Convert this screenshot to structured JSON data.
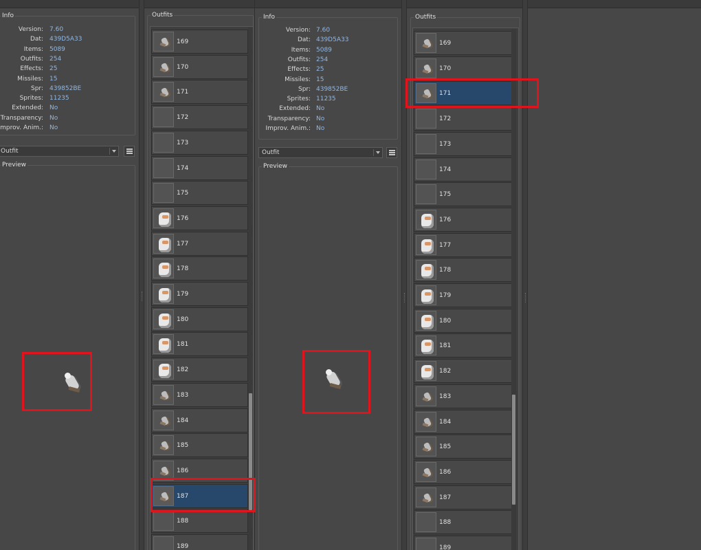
{
  "left": {
    "info": {
      "title": "Info",
      "rows": [
        {
          "key": "Version:",
          "value": "7.60"
        },
        {
          "key": "Dat:",
          "value": "439D5A33"
        },
        {
          "key": "Items:",
          "value": "5089"
        },
        {
          "key": "Outfits:",
          "value": "254"
        },
        {
          "key": "Effects:",
          "value": "25"
        },
        {
          "key": "Missiles:",
          "value": "15"
        },
        {
          "key": "Spr:",
          "value": "439852BE"
        },
        {
          "key": "Sprites:",
          "value": "11235"
        },
        {
          "key": "Extended:",
          "value": "No"
        },
        {
          "key": "Transparency:",
          "value": "No"
        },
        {
          "key": "Improv. Anim.:",
          "value": "No"
        }
      ]
    },
    "category_select": "Outfit",
    "preview_title": "Preview",
    "outfits_title": "Outfits",
    "outfits": [
      {
        "id": "169",
        "icon": "outfit-small-icon"
      },
      {
        "id": "170",
        "icon": "outfit-small-icon"
      },
      {
        "id": "171",
        "icon": "outfit-small-icon"
      },
      {
        "id": "172",
        "icon": ""
      },
      {
        "id": "173",
        "icon": ""
      },
      {
        "id": "174",
        "icon": ""
      },
      {
        "id": "175",
        "icon": ""
      },
      {
        "id": "176",
        "icon": "outfit-large-icon"
      },
      {
        "id": "177",
        "icon": "outfit-large-icon"
      },
      {
        "id": "178",
        "icon": "outfit-large-icon"
      },
      {
        "id": "179",
        "icon": "outfit-large-icon"
      },
      {
        "id": "180",
        "icon": "outfit-large-icon"
      },
      {
        "id": "181",
        "icon": "outfit-large-icon"
      },
      {
        "id": "182",
        "icon": "outfit-large-icon"
      },
      {
        "id": "183",
        "icon": "outfit-small-icon"
      },
      {
        "id": "184",
        "icon": "outfit-small-icon"
      },
      {
        "id": "185",
        "icon": "outfit-small-icon"
      },
      {
        "id": "186",
        "icon": "outfit-small-icon"
      },
      {
        "id": "187",
        "icon": "outfit-small-icon"
      },
      {
        "id": "188",
        "icon": ""
      },
      {
        "id": "189",
        "icon": ""
      }
    ],
    "selected_outfit": "187"
  },
  "right": {
    "info": {
      "title": "Info",
      "rows": [
        {
          "key": "Version:",
          "value": "7.60"
        },
        {
          "key": "Dat:",
          "value": "439D5A33"
        },
        {
          "key": "Items:",
          "value": "5089"
        },
        {
          "key": "Outfits:",
          "value": "254"
        },
        {
          "key": "Effects:",
          "value": "25"
        },
        {
          "key": "Missiles:",
          "value": "15"
        },
        {
          "key": "Spr:",
          "value": "439852BE"
        },
        {
          "key": "Sprites:",
          "value": "11235"
        },
        {
          "key": "Extended:",
          "value": "No"
        },
        {
          "key": "Transparency:",
          "value": "No"
        },
        {
          "key": "Improv. Anim.:",
          "value": "No"
        }
      ]
    },
    "category_select": "Outfit",
    "preview_title": "Preview",
    "outfits_title": "Outfits",
    "outfits": [
      {
        "id": "169",
        "icon": "outfit-small-icon"
      },
      {
        "id": "170",
        "icon": "outfit-small-icon"
      },
      {
        "id": "171",
        "icon": "outfit-small-icon"
      },
      {
        "id": "172",
        "icon": ""
      },
      {
        "id": "173",
        "icon": ""
      },
      {
        "id": "174",
        "icon": ""
      },
      {
        "id": "175",
        "icon": ""
      },
      {
        "id": "176",
        "icon": "outfit-large-icon"
      },
      {
        "id": "177",
        "icon": "outfit-large-icon"
      },
      {
        "id": "178",
        "icon": "outfit-large-icon"
      },
      {
        "id": "179",
        "icon": "outfit-large-icon"
      },
      {
        "id": "180",
        "icon": "outfit-large-icon"
      },
      {
        "id": "181",
        "icon": "outfit-large-icon"
      },
      {
        "id": "182",
        "icon": "outfit-large-icon"
      },
      {
        "id": "183",
        "icon": "outfit-small-icon"
      },
      {
        "id": "184",
        "icon": "outfit-small-icon"
      },
      {
        "id": "185",
        "icon": "outfit-small-icon"
      },
      {
        "id": "186",
        "icon": "outfit-small-icon"
      },
      {
        "id": "187",
        "icon": "outfit-small-icon"
      },
      {
        "id": "188",
        "icon": ""
      },
      {
        "id": "189",
        "icon": ""
      }
    ],
    "selected_outfit": "171"
  },
  "colors": {
    "background": "#484848",
    "info_value": "#8fb8e6",
    "selection": "#27486b",
    "highlight_box": "#e0141c"
  }
}
